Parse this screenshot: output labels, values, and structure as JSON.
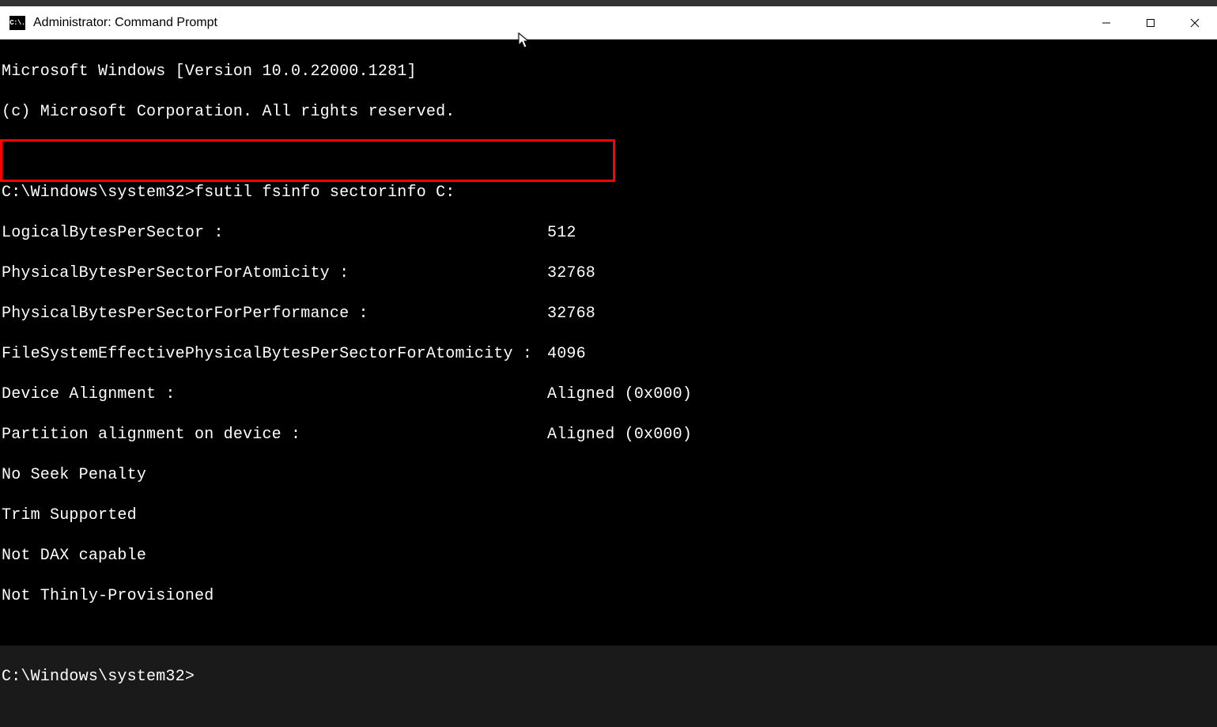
{
  "window": {
    "title": "Administrator: Command Prompt",
    "icon_label": "C:\\."
  },
  "terminal": {
    "header_line1": "Microsoft Windows [Version 10.0.22000.1281]",
    "header_line2": "(c) Microsoft Corporation. All rights reserved.",
    "prompt_path": "C:\\Windows\\system32>",
    "command": "fsutil fsinfo sectorinfo C:",
    "rows": [
      {
        "label": "LogicalBytesPerSector :",
        "value": "512"
      },
      {
        "label": "PhysicalBytesPerSectorForAtomicity :",
        "value": "32768"
      },
      {
        "label": "PhysicalBytesPerSectorForPerformance :",
        "value": "32768"
      },
      {
        "label": "FileSystemEffectivePhysicalBytesPerSectorForAtomicity :",
        "value": "4096"
      },
      {
        "label": "Device Alignment :",
        "value": "Aligned (0x000)"
      },
      {
        "label": "Partition alignment on device :",
        "value": "Aligned (0x000)"
      }
    ],
    "flags": [
      "No Seek Penalty",
      "Trim Supported",
      "Not DAX capable",
      "Not Thinly-Provisioned"
    ],
    "prompt_path2": "C:\\Windows\\system32>"
  }
}
